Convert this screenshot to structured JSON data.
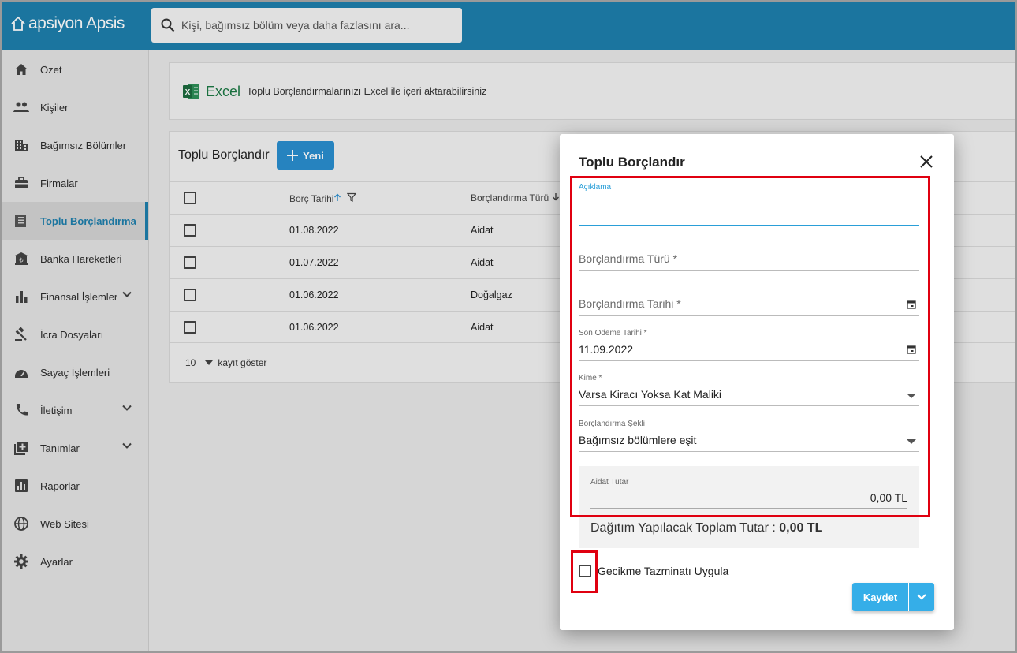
{
  "app": {
    "brand": "apsiyon Apsis"
  },
  "search": {
    "placeholder": "Kişi, bağımsız bölüm veya daha fazlasını ara..."
  },
  "sidebar": {
    "items": [
      {
        "label": "Özet",
        "icon": "home-icon"
      },
      {
        "label": "Kişiler",
        "icon": "people-icon"
      },
      {
        "label": "Bağımsız Bölümler",
        "icon": "building-icon"
      },
      {
        "label": "Firmalar",
        "icon": "briefcase-icon"
      },
      {
        "label": "Toplu Borçlandırma",
        "icon": "receipt-icon",
        "active": true
      },
      {
        "label": "Banka Hareketleri",
        "icon": "bank-icon"
      },
      {
        "label": "Finansal İşlemler",
        "icon": "bar-chart-icon",
        "expandable": true
      },
      {
        "label": "İcra Dosyaları",
        "icon": "gavel-icon"
      },
      {
        "label": "Sayaç İşlemleri",
        "icon": "meter-icon"
      },
      {
        "label": "İletişim",
        "icon": "phone-icon",
        "expandable": true
      },
      {
        "label": "Tanımlar",
        "icon": "library-add-icon",
        "expandable": true
      },
      {
        "label": "Raporlar",
        "icon": "report-icon"
      },
      {
        "label": "Web Sitesi",
        "icon": "globe-icon"
      },
      {
        "label": "Ayarlar",
        "icon": "gear-icon"
      }
    ]
  },
  "excel": {
    "label": "Excel",
    "description": "Toplu Borçlandırmalarınızı Excel ile içeri aktarabilirsiniz"
  },
  "list": {
    "title": "Toplu Borçlandır",
    "new_label": "Yeni",
    "columns": [
      "Borç Tarihi",
      "Borçlandırma Türü"
    ],
    "rows": [
      {
        "date": "01.08.2022",
        "type": "Aidat"
      },
      {
        "date": "01.07.2022",
        "type": "Aidat"
      },
      {
        "date": "01.06.2022",
        "type": "Doğalgaz"
      },
      {
        "date": "01.06.2022",
        "type": "Aidat"
      }
    ],
    "page_size": "10",
    "page_size_label": "kayıt göster"
  },
  "modal": {
    "title": "Toplu Borçlandır",
    "aciklama_label": "Açıklama",
    "tur_placeholder": "Borçlandırma Türü *",
    "tarih_placeholder": "Borçlandırma Tarihi *",
    "son_odeme_label": "Son Odeme Tarihi *",
    "son_odeme_value": "11.09.2022",
    "kime_label": "Kime *",
    "kime_value": "Varsa Kiracı Yoksa Kat Maliki",
    "sekil_label": "Borçlandırma Şekli",
    "sekil_value": "Bağımsız bölümlere eşit",
    "aidat_label": "Aidat Tutar",
    "aidat_value": "0,00 TL",
    "total_label": "Dağıtım Yapılacak Toplam Tutar : ",
    "total_value": "0,00 TL",
    "gecikme_label": "Gecikme Tazminatı Uygula",
    "save_label": "Kaydet"
  },
  "colors": {
    "brand": "#1e7fad",
    "accent": "#35aee8",
    "highlight": "#e00010"
  }
}
